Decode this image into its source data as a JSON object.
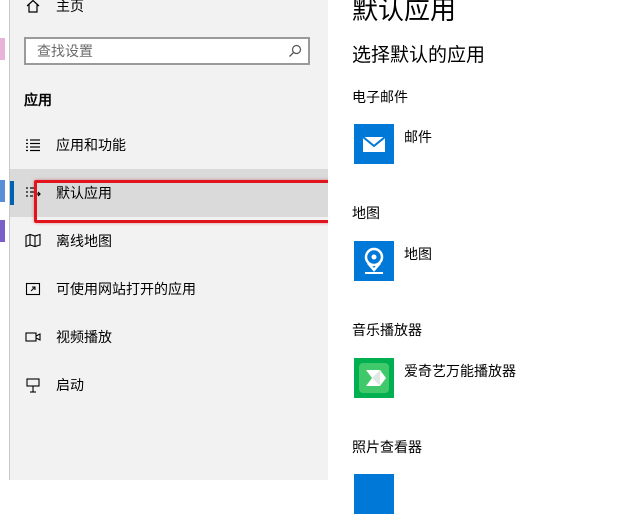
{
  "sidebar": {
    "home_label": "主页",
    "search_placeholder": "查找设置",
    "section_title": "应用",
    "items": [
      {
        "label": "应用和功能",
        "icon": "apps-list-icon"
      },
      {
        "label": "默认应用",
        "icon": "default-apps-icon",
        "selected": true
      },
      {
        "label": "离线地图",
        "icon": "offline-maps-icon"
      },
      {
        "label": "可使用网站打开的应用",
        "icon": "apps-for-websites-icon"
      },
      {
        "label": "视频播放",
        "icon": "video-playback-icon"
      },
      {
        "label": "启动",
        "icon": "startup-icon"
      }
    ]
  },
  "main": {
    "title": "默认应用",
    "subtitle": "选择默认的应用",
    "categories": [
      {
        "label": "电子邮件",
        "app": "邮件",
        "icon": "mail-app-icon",
        "color": "#0078d7"
      },
      {
        "label": "地图",
        "app": "地图",
        "icon": "maps-app-icon",
        "color": "#0078d7"
      },
      {
        "label": "音乐播放器",
        "app": "爱奇艺万能播放器",
        "icon": "iqiyi-player-icon",
        "color": "#00b050"
      },
      {
        "label": "照片查看器",
        "app": "",
        "icon": "photo-viewer-app-icon",
        "color": "#0078d7"
      }
    ]
  },
  "colors": {
    "accent": "#0078d7",
    "selection_indicator": "#0063b1",
    "highlight_annotation": "#e0141d"
  }
}
